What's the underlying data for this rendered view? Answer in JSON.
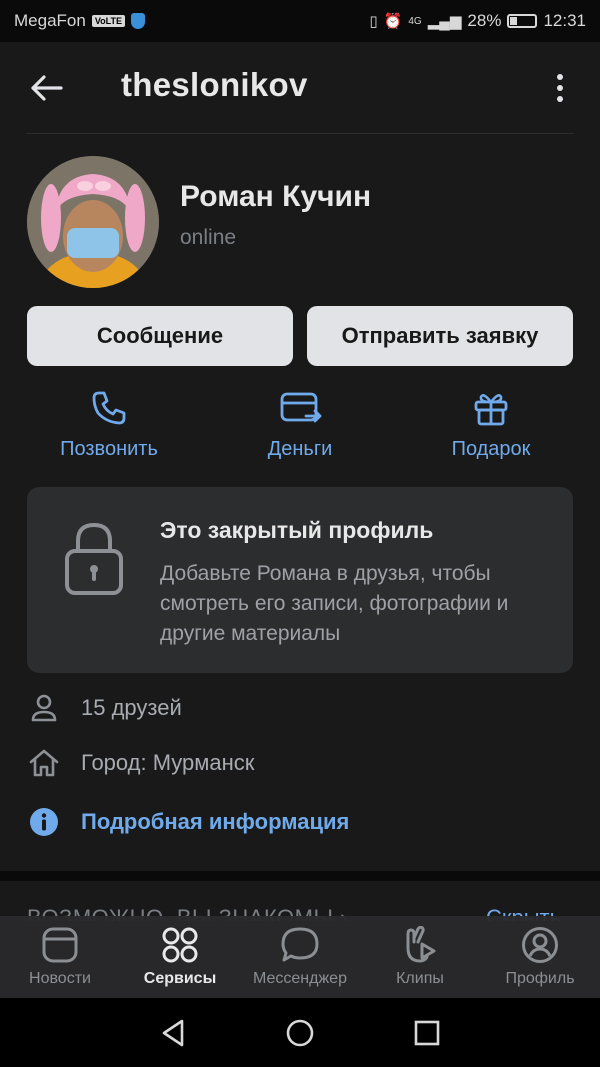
{
  "status_bar": {
    "carrier": "MegaFon",
    "volte": "VoLTE",
    "network": "4G",
    "battery": "28%",
    "time": "12:31"
  },
  "header": {
    "title": "theslonikov"
  },
  "profile": {
    "name": "Роман Кучин",
    "status": "online"
  },
  "buttons": {
    "message": "Сообщение",
    "request": "Отправить заявку"
  },
  "actions": [
    {
      "label": "Позвонить",
      "icon": "phone-icon"
    },
    {
      "label": "Деньги",
      "icon": "money-transfer-icon"
    },
    {
      "label": "Подарок",
      "icon": "gift-icon"
    }
  ],
  "closed_profile": {
    "title": "Это закрытый профиль",
    "text": "Добавьте Романа в друзья, чтобы смотреть его записи, фотографии и другие материалы"
  },
  "info": {
    "friends": "15 друзей",
    "city": "Город: Мурманск",
    "details": "Подробная информация"
  },
  "suggestions": {
    "title": "ВОЗМОЖНО, ВЫ ЗНАКОМЫ ›",
    "hide": "Скрыть"
  },
  "tabs": [
    {
      "label": "Новости",
      "icon": "news-icon",
      "active": false
    },
    {
      "label": "Сервисы",
      "icon": "services-icon",
      "active": true
    },
    {
      "label": "Мессенджер",
      "icon": "messenger-icon",
      "active": false
    },
    {
      "label": "Клипы",
      "icon": "clips-icon",
      "active": false
    },
    {
      "label": "Профиль",
      "icon": "profile-icon",
      "active": false
    }
  ],
  "colors": {
    "accent": "#71aaeb",
    "background": "#19191a",
    "card": "#2c2d2e",
    "button": "#e1e3e6"
  }
}
